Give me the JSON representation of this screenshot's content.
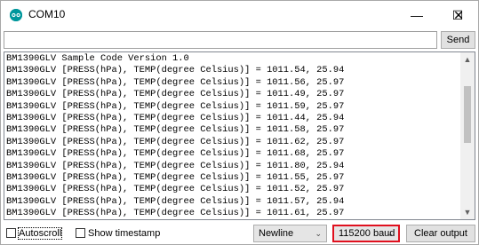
{
  "window": {
    "title": "COM10",
    "minimize_glyph": "—",
    "maximize_glyph": "☐",
    "close_glyph": "✕"
  },
  "send_row": {
    "input_value": "",
    "send_label": "Send"
  },
  "output": {
    "lines": [
      "BM1390GLV Sample Code Version 1.0",
      "BM1390GLV [PRESS(hPa), TEMP(degree Celsius)] = 1011.54, 25.94",
      "BM1390GLV [PRESS(hPa), TEMP(degree Celsius)] = 1011.56, 25.97",
      "BM1390GLV [PRESS(hPa), TEMP(degree Celsius)] = 1011.49, 25.97",
      "BM1390GLV [PRESS(hPa), TEMP(degree Celsius)] = 1011.59, 25.97",
      "BM1390GLV [PRESS(hPa), TEMP(degree Celsius)] = 1011.44, 25.94",
      "BM1390GLV [PRESS(hPa), TEMP(degree Celsius)] = 1011.58, 25.97",
      "BM1390GLV [PRESS(hPa), TEMP(degree Celsius)] = 1011.62, 25.97",
      "BM1390GLV [PRESS(hPa), TEMP(degree Celsius)] = 1011.68, 25.97",
      "BM1390GLV [PRESS(hPa), TEMP(degree Celsius)] = 1011.80, 25.94",
      "BM1390GLV [PRESS(hPa), TEMP(degree Celsius)] = 1011.55, 25.97",
      "BM1390GLV [PRESS(hPa), TEMP(degree Celsius)] = 1011.52, 25.97",
      "BM1390GLV [PRESS(hPa), TEMP(degree Celsius)] = 1011.57, 25.94",
      "BM1390GLV [PRESS(hPa), TEMP(degree Celsius)] = 1011.61, 25.97"
    ],
    "scroll_up_glyph": "▲",
    "scroll_down_glyph": "▼"
  },
  "bottom_bar": {
    "autoscroll_label": "Autoscroll",
    "autoscroll_checked": false,
    "timestamp_label": "Show timestamp",
    "timestamp_checked": false,
    "line_ending_value": "Newline",
    "baud_value": "115200 baud",
    "clear_label": "Clear output",
    "chevron_glyph": "⌄"
  },
  "colors": {
    "app_icon": "#00979c",
    "baud_highlight": "#e0101e"
  }
}
